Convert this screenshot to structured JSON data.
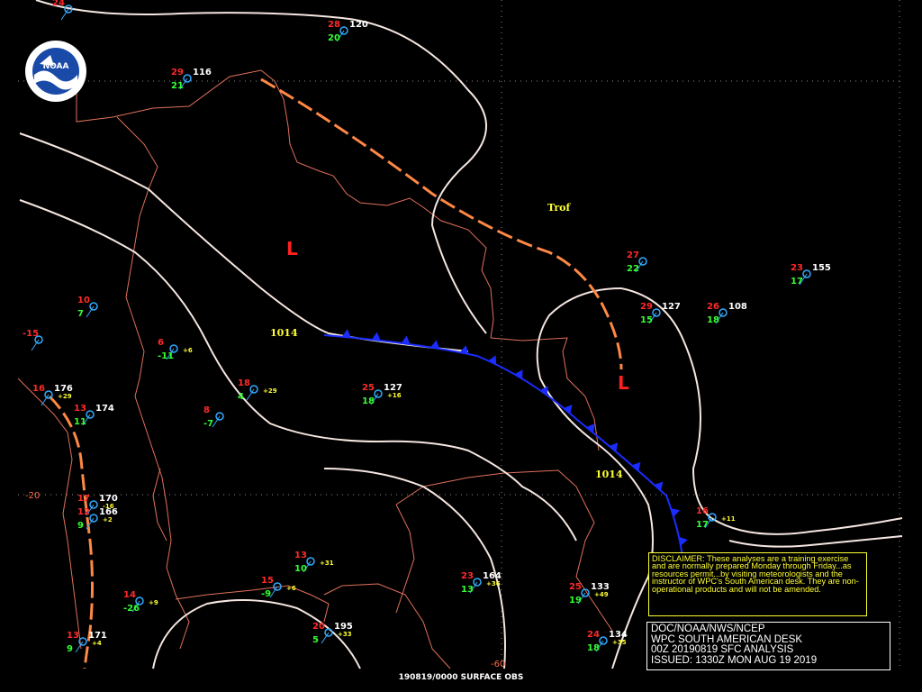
{
  "title": {
    "lines": [
      "DOC/NOAA/NWS/NCEP",
      "WPC SOUTH AMERICAN DESK",
      "00Z 20190819 SFC ANALYSIS",
      "ISSUED: 1330Z MON AUG 19 2019"
    ]
  },
  "disclaimer": {
    "text": "DISCLAIMER: These analyses are a training exercise and are normally prepared Monday through Friday...as resources permit...by visiting meteorologists and the instructor of WPC's South American desk. They are non-operational products and will not be amended."
  },
  "footer": {
    "text": "190819/0000 SURFACE OBS"
  },
  "logo": {
    "text": "NOAA"
  },
  "features": {
    "lows": [
      {
        "label": "L"
      },
      {
        "label": "L"
      }
    ],
    "trough_label": "Trof",
    "isobar_labels": [
      "1014",
      "1014"
    ],
    "lat_labels": [
      "-20",
      "-60"
    ]
  },
  "colors": {
    "background": "#000000",
    "isobar": "#f5e6e0",
    "border": "#e0705a",
    "trough": "#ff8844",
    "cold_front": "#1a2cff",
    "low": "#ff2020",
    "grid": "#888888"
  },
  "stations": [
    {
      "t": "24",
      "td": "",
      "p": "",
      "tend": ""
    },
    {
      "t": "28",
      "td": "20",
      "p": "120",
      "tend": ""
    },
    {
      "t": "29",
      "td": "21",
      "p": "116",
      "tend": ""
    },
    {
      "t": "27",
      "td": "22",
      "p": "",
      "tend": ""
    },
    {
      "t": "23",
      "td": "17",
      "p": "155",
      "tend": ""
    },
    {
      "t": "29",
      "td": "15",
      "p": "127",
      "tend": ""
    },
    {
      "t": "26",
      "td": "18",
      "p": "108",
      "tend": ""
    },
    {
      "t": "10",
      "td": "7",
      "p": "",
      "tend": ""
    },
    {
      "t": "-15",
      "td": "",
      "p": "",
      "tend": ""
    },
    {
      "t": "6",
      "td": "-11",
      "p": "",
      "tend": "+6"
    },
    {
      "t": "18",
      "td": "4",
      "p": "",
      "tend": "+29"
    },
    {
      "t": "25",
      "td": "18",
      "p": "127",
      "tend": "+16"
    },
    {
      "t": "16",
      "td": "",
      "p": "176",
      "tend": "+29"
    },
    {
      "t": "13",
      "td": "11",
      "p": "174",
      "tend": ""
    },
    {
      "t": "8",
      "td": "-7",
      "p": "",
      "tend": ""
    },
    {
      "t": "17",
      "td": "",
      "p": "170",
      "tend": "-16"
    },
    {
      "t": "12",
      "td": "9",
      "p": "166",
      "tend": "+2"
    },
    {
      "t": "16",
      "td": "17",
      "p": "",
      "tend": "+11"
    },
    {
      "t": "13",
      "td": "10",
      "p": "",
      "tend": "+31"
    },
    {
      "t": "15",
      "td": "-9",
      "p": "",
      "tend": "+6"
    },
    {
      "t": "23",
      "td": "13",
      "p": "164",
      "tend": "+36"
    },
    {
      "t": "25",
      "td": "19",
      "p": "133",
      "tend": "+49"
    },
    {
      "t": "14",
      "td": "-26",
      "p": "",
      "tend": "+9"
    },
    {
      "t": "20",
      "td": "5",
      "p": "195",
      "tend": "+33"
    },
    {
      "t": "24",
      "td": "18",
      "p": "134",
      "tend": "+35"
    },
    {
      "t": "13",
      "td": "9",
      "p": "171",
      "tend": "+4"
    }
  ]
}
